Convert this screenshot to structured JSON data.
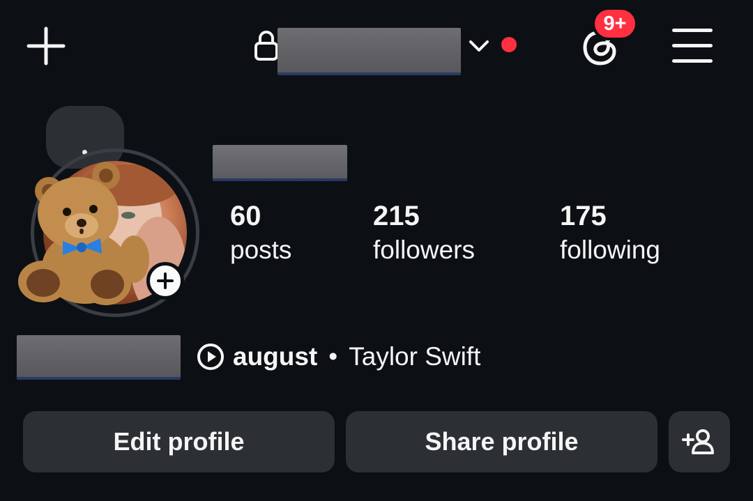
{
  "header": {
    "new_post_icon": "plus-icon",
    "privacy_icon": "lock-icon",
    "username": "",
    "switch_icon": "chevron-down-icon",
    "threads_icon": "threads-icon",
    "threads_badge": "9+",
    "menu_icon": "hamburger-menu-icon"
  },
  "profile": {
    "display_name": "",
    "stats": [
      {
        "value": "60",
        "label": "posts"
      },
      {
        "value": "215",
        "label": "followers"
      },
      {
        "value": "175",
        "label": "following"
      }
    ],
    "bio": "",
    "music": {
      "icon": "play-circle-icon",
      "song": "august",
      "separator": "•",
      "artist": "Taylor Swift"
    }
  },
  "actions": {
    "edit_label": "Edit profile",
    "share_label": "Share profile",
    "suggest_icon": "add-person-icon"
  },
  "colors": {
    "background": "#0c1014",
    "button": "#2c3035",
    "badge": "#ff3040",
    "text": "#f5f5f5"
  }
}
